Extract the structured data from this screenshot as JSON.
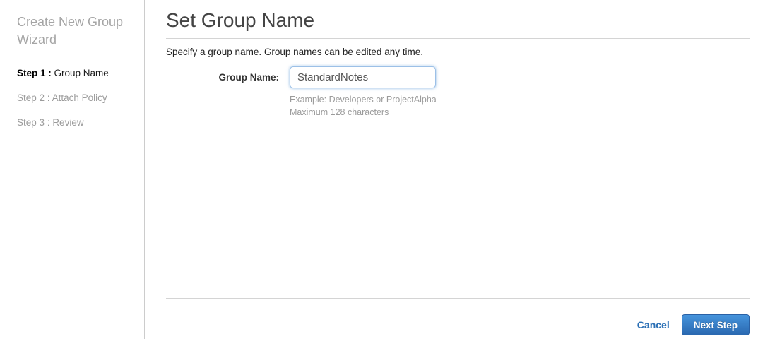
{
  "sidebar": {
    "title": "Create New Group Wizard",
    "steps": [
      {
        "prefix": "Step 1 :",
        "label": "Group Name"
      },
      {
        "prefix": "Step 2 :",
        "label": "Attach Policy"
      },
      {
        "prefix": "Step 3 :",
        "label": "Review"
      }
    ]
  },
  "main": {
    "title": "Set Group Name",
    "description": "Specify a group name. Group names can be edited any time."
  },
  "form": {
    "group_name_label": "Group Name:",
    "group_name_value": "StandardNotes",
    "hint_example": "Example: Developers or ProjectAlpha",
    "hint_max": "Maximum 128 characters"
  },
  "footer": {
    "cancel_label": "Cancel",
    "next_label": "Next Step"
  },
  "colors": {
    "link_blue": "#2a6fb5",
    "button_gradient_top": "#4694dc",
    "button_gradient_bottom": "#2a68b0",
    "input_focus_border": "#9cc0e7",
    "divider_gray": "#d4d4d4"
  }
}
